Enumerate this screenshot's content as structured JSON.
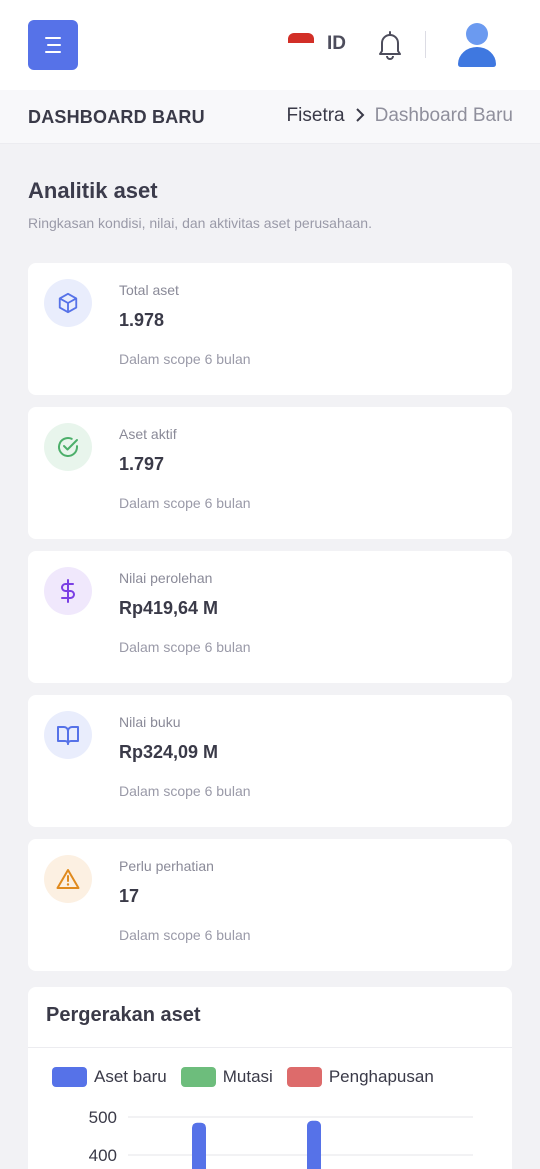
{
  "header": {
    "lang_code": "ID",
    "icons": [
      "menu-icon",
      "flag-id-icon",
      "bell-icon",
      "user-avatar-icon"
    ],
    "accent": "#5672e8"
  },
  "breadcrumb": {
    "page_title": "DASHBOARD BARU",
    "root": "Fisetra",
    "separator": ">",
    "current": "Dashboard Baru"
  },
  "section": {
    "title": "Analitik aset",
    "subtitle": "Ringkasan kondisi, nilai, dan aktivitas aset perusahaan."
  },
  "stats": [
    {
      "label": "Total aset",
      "value": "1.978",
      "note": "Dalam scope 6 bulan",
      "icon": "cube-icon",
      "color": "#5672e8"
    },
    {
      "label": "Aset aktif",
      "value": "1.797",
      "note": "Dalam scope 6 bulan",
      "icon": "check-circle-icon",
      "color": "#4caf6a"
    },
    {
      "label": "Nilai perolehan",
      "value": "Rp419,64 M",
      "note": "Dalam scope 6 bulan",
      "icon": "dollar-icon",
      "color": "#7b3fe4"
    },
    {
      "label": "Nilai buku",
      "value": "Rp324,09 M",
      "note": "Dalam scope 6 bulan",
      "icon": "book-icon",
      "color": "#5672e8"
    },
    {
      "label": "Perlu perhatian",
      "value": "17",
      "note": "Dalam scope 6 bulan",
      "icon": "warning-icon",
      "color": "#e08a1e"
    }
  ],
  "movement": {
    "title": "Pergerakan aset"
  },
  "chart_data": {
    "type": "bar",
    "title": "Pergerakan aset",
    "series": [
      {
        "name": "Aset baru",
        "color": "#5672e8",
        "values": [
          485,
          490
        ]
      },
      {
        "name": "Mutasi",
        "color": "#6dbd7c",
        "values": []
      },
      {
        "name": "Penghapusan",
        "color": "#dd6b6b",
        "values": []
      }
    ],
    "y_ticks": [
      "500",
      "400"
    ],
    "ylim": [
      400,
      500
    ],
    "legend": "top-left",
    "grid": true
  }
}
